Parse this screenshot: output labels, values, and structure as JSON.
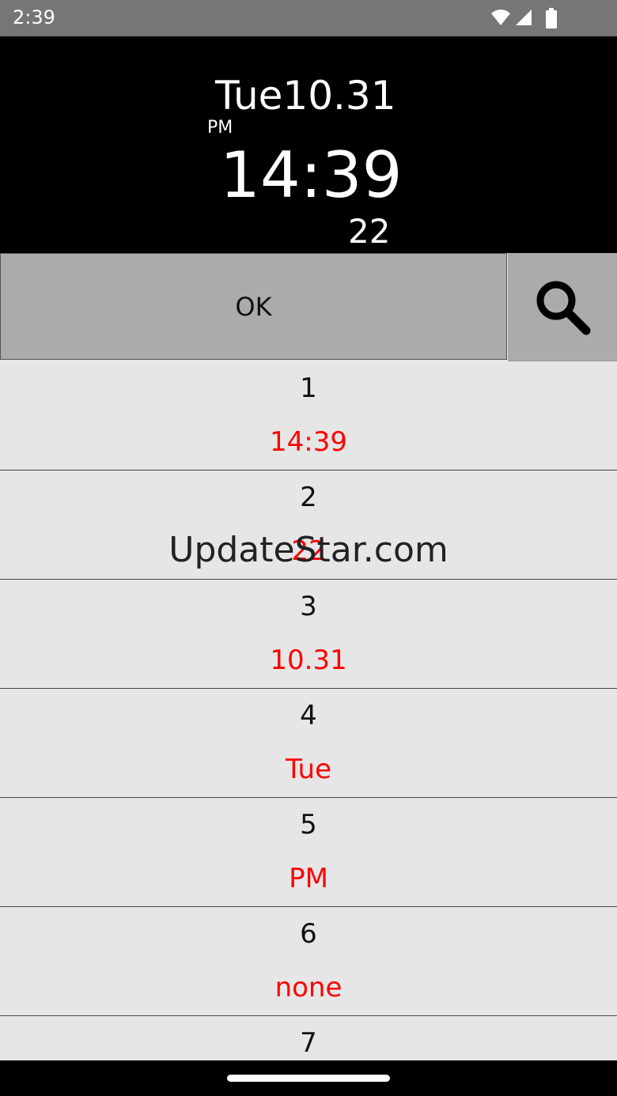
{
  "status_bar": {
    "time": "2:39",
    "icons": [
      "wifi-icon",
      "signal-icon",
      "battery-icon"
    ]
  },
  "clock": {
    "day": "Tue",
    "date": "10.31",
    "ampm": "PM",
    "time": "14:39",
    "seconds": "22"
  },
  "toolbar": {
    "ok_label": "OK",
    "search_icon": "search-icon"
  },
  "list": {
    "items": [
      {
        "index": "1",
        "value": "14:39"
      },
      {
        "index": "2",
        "value": "22"
      },
      {
        "index": "3",
        "value": "10.31"
      },
      {
        "index": "4",
        "value": "Tue"
      },
      {
        "index": "5",
        "value": "PM"
      },
      {
        "index": "6",
        "value": "none"
      },
      {
        "index": "7",
        "value": ""
      }
    ]
  },
  "watermark": "UpdateStar.com",
  "colors": {
    "value_text": "#ff0000",
    "list_bg": "#e6e6e6",
    "button_bg": "#ababab",
    "clock_bg": "#000000"
  }
}
